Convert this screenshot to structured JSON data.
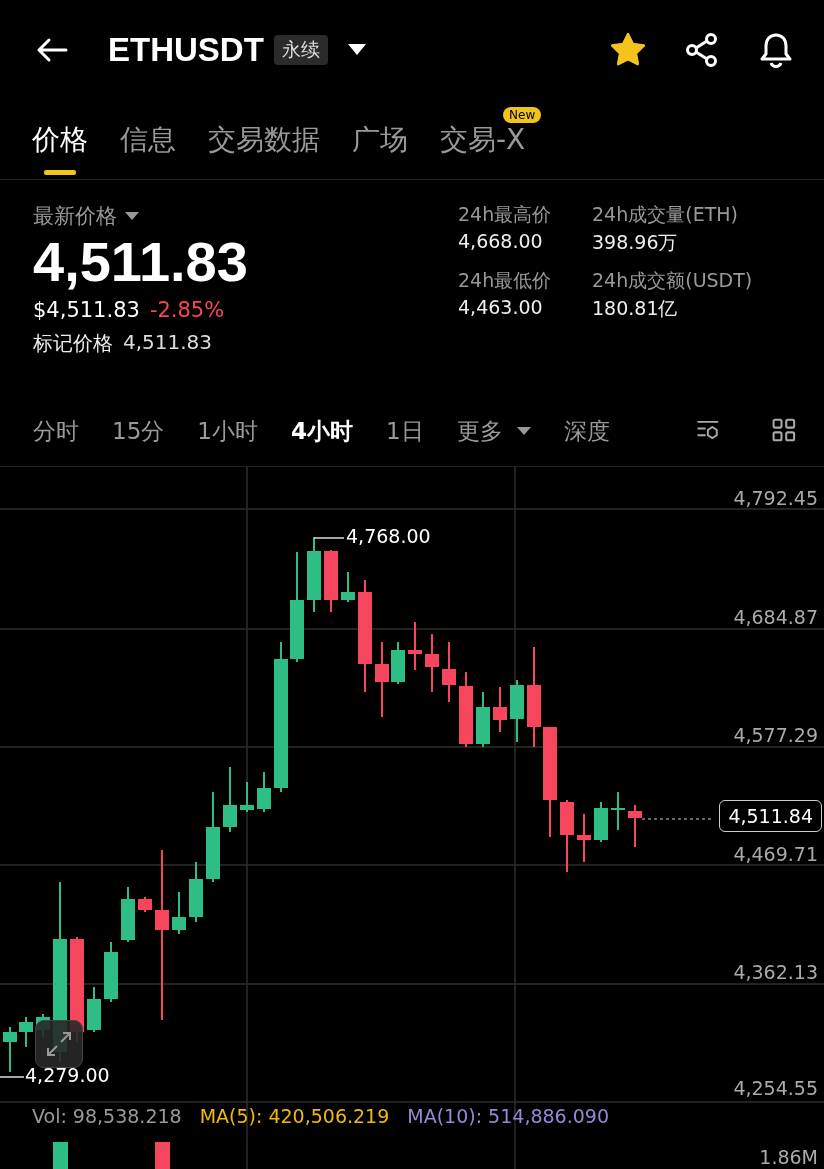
{
  "header": {
    "title": "ETHUSDT",
    "badge": "永续",
    "favorited": true
  },
  "tabs": [
    {
      "label": "价格",
      "selected": true
    },
    {
      "label": "信息",
      "selected": false
    },
    {
      "label": "交易数据",
      "selected": false
    },
    {
      "label": "广场",
      "selected": false
    },
    {
      "label": "交易-X",
      "selected": false,
      "badge": "New"
    }
  ],
  "price": {
    "label": "最新价格",
    "last": "4,511.83",
    "usd": "$4,511.83",
    "change": "-2.85%",
    "mark_label": "标记价格",
    "mark_value": "4,511.83"
  },
  "stats": [
    {
      "label": "24h最高价",
      "value": "4,668.00"
    },
    {
      "label": "24h成交量(ETH)",
      "value": "398.96万"
    },
    {
      "label": "24h最低价",
      "value": "4,463.00"
    },
    {
      "label": "24h成交额(USDT)",
      "value": "180.81亿"
    }
  ],
  "intervals": [
    {
      "label": "分时",
      "selected": false,
      "kind": "text"
    },
    {
      "label": "15分",
      "selected": false,
      "kind": "text"
    },
    {
      "label": "1小时",
      "selected": false,
      "kind": "text"
    },
    {
      "label": "4小时",
      "selected": true,
      "kind": "text"
    },
    {
      "label": "1日",
      "selected": false,
      "kind": "text"
    },
    {
      "label": "更多",
      "selected": false,
      "kind": "dropdown"
    },
    {
      "label": "深度",
      "selected": false,
      "kind": "text"
    }
  ],
  "chart": {
    "price_axis": [
      "4,792.45",
      "4,684.87",
      "4,577.29",
      "4,469.71",
      "4,362.13",
      "4,254.55"
    ],
    "current_price": "4,511.84",
    "high_marker": "4,768.00",
    "low_marker": "4,279.00",
    "volume_axis": "1.86M"
  },
  "volume_row": {
    "vol": "Vol: 98,538.218",
    "ma5": "MA(5): 420,506.219",
    "ma10": "MA(10): 514,886.090"
  }
}
